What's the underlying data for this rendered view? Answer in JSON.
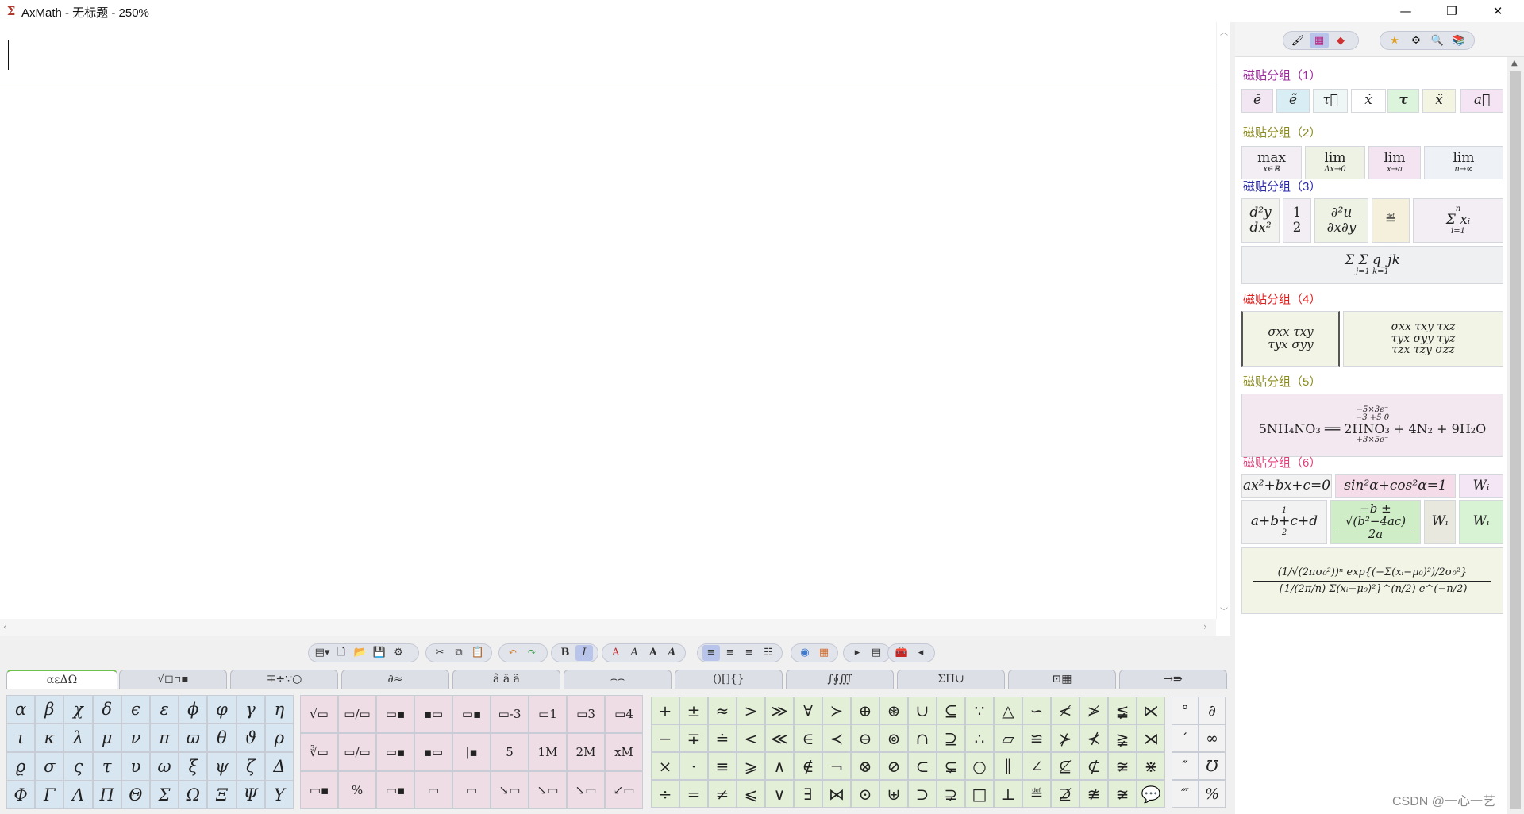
{
  "window": {
    "title": "AxMath - 无标题 - 250%",
    "app_icon": "Σ",
    "controls": {
      "minimize": "—",
      "maximize": "❐",
      "close": "✕"
    }
  },
  "editor": {
    "content": ""
  },
  "toolbar": {
    "groups": [
      [
        "▤▾",
        "🗋",
        "📂",
        "💾",
        "⚙"
      ],
      [
        "✂",
        "⧉",
        "📋"
      ],
      [
        "↶",
        "↷"
      ],
      [
        "B",
        "I"
      ],
      [
        "A",
        "A",
        "A",
        "A"
      ],
      [
        "≡",
        "≡",
        "≡",
        "☷"
      ],
      [
        "◉",
        "▦"
      ],
      [
        "▸",
        "▤"
      ],
      [
        "🧰",
        "◂"
      ]
    ]
  },
  "symbol_tabs": [
    "αεΔΩ",
    "√◻▫▪",
    "∓÷∵○",
    "∂≈",
    "â ä ã",
    "⌢⌢",
    "()[]{}",
    "∫∮∭",
    "ΣΠ∪",
    "⊡▦",
    "→⇛"
  ],
  "greek_grid": [
    [
      "α",
      "β",
      "χ",
      "δ",
      "ϵ",
      "ε",
      "ϕ",
      "φ",
      "γ",
      "η"
    ],
    [
      "ι",
      "κ",
      "λ",
      "μ",
      "ν",
      "π",
      "ϖ",
      "θ",
      "ϑ",
      "ρ"
    ],
    [
      "ϱ",
      "σ",
      "ς",
      "τ",
      "υ",
      "ω",
      "ξ",
      "ψ",
      "ζ",
      "Δ"
    ],
    [
      "Φ",
      "Γ",
      "Λ",
      "Π",
      "Θ",
      "Σ",
      "Ω",
      "Ξ",
      "Ψ",
      "Υ"
    ]
  ],
  "template_grid": [
    [
      "√▭",
      "▭/▭",
      "▭▪",
      "▪▭",
      "▭▪",
      "▭-3",
      "▭1",
      "▭3",
      "▭4"
    ],
    [
      "∛▭",
      "▭/▭",
      "▭▪",
      "▪▭",
      "|▪",
      "5",
      "1M",
      "2M",
      "xM"
    ],
    [
      "▭▪",
      "%",
      "▭▪",
      "▭",
      "▭",
      "↘▭",
      "↘▭",
      "↘▭",
      "↙▭"
    ]
  ],
  "template_labels": {
    "r0c5": "−3",
    "r0c6": "1",
    "r0c7": "3",
    "r0c8": "4",
    "r1c5": "5",
    "r1c6": "1M",
    "r1c7": "2M",
    "r1c8": "xM"
  },
  "operator_grid": [
    [
      "+",
      "±",
      "≈",
      ">",
      "≫",
      "∀",
      "≻",
      "⊕",
      "⊛",
      "∪",
      "⊆",
      "∵",
      "△",
      "∽",
      "≮",
      "≯",
      "≨",
      "⋉"
    ],
    [
      "−",
      "∓",
      "≐",
      "<",
      "≪",
      "∈",
      "≺",
      "⊖",
      "⊚",
      "∩",
      "⊇",
      "∴",
      "▱",
      "≌",
      "⊁",
      "⊀",
      "≩",
      "⋊"
    ],
    [
      "×",
      "·",
      "≡",
      "⩾",
      "∧",
      "∉",
      "¬",
      "⊗",
      "⊘",
      "⊂",
      "⊊",
      "○",
      "∥",
      "∠",
      "⊈",
      "⊄",
      "≆",
      "⋇"
    ],
    [
      "÷",
      "=",
      "≠",
      "⩽",
      "∨",
      "∃",
      "⋈",
      "⊙",
      "⊎",
      "⊃",
      "⊋",
      "□",
      "⊥",
      "≝",
      "⊉",
      "≇",
      "≆",
      "💬"
    ]
  ],
  "misc_grid": [
    [
      "°",
      "∂"
    ],
    [
      "′",
      "∞"
    ],
    [
      "″",
      "℧"
    ],
    [
      "‴",
      "%"
    ]
  ],
  "sidebar": {
    "toolbar_left": [
      "🖌",
      "▦",
      "◆"
    ],
    "toolbar_right": [
      "★",
      "⚙",
      "🔍",
      "📚"
    ],
    "groups": [
      {
        "label": "磁贴分组（1）",
        "color": "#9b2a9b"
      },
      {
        "label": "磁贴分组（2）",
        "color": "#8a8a1e"
      },
      {
        "label": "磁贴分组（3）",
        "color": "#2a2aa8"
      },
      {
        "label": "磁贴分组（4）",
        "color": "#e02020"
      },
      {
        "label": "磁贴分组（5）",
        "color": "#8a8a1e"
      },
      {
        "label": "磁贴分组（6）",
        "color": "#e0407a"
      }
    ],
    "tiles_g1": [
      "ē",
      "ẽ",
      "τ⃗",
      "ẋ",
      "τ",
      "ẍ",
      "a⃗"
    ],
    "tiles_g2": [
      {
        "top": "max",
        "sub": "x∈ℝ"
      },
      {
        "top": "lim",
        "sub": "Δx→0"
      },
      {
        "top": "lim",
        "sub": "x→a"
      },
      {
        "top": "lim",
        "sub": "n→∞"
      }
    ],
    "tiles_g3": {
      "deriv_num": "d²y",
      "deriv_den": "dx²",
      "half_num": "1",
      "half_den": "2",
      "pd_num": "∂²u",
      "pd_den": "∂x∂y",
      "def": "≝",
      "sum_top": "n",
      "sum_body": "Σ xᵢ",
      "sum_bottom": "i=1",
      "dsum": "Σ Σ q_jk",
      "dsum_sub": "j=1  k=1"
    },
    "tiles_g4": {
      "m2": [
        "σxx  τxy",
        "τyx  σyy"
      ],
      "m3": [
        "σxx  τxy  τxz",
        "τyx  σyy  τyz",
        "τzx  τzy  σzz"
      ]
    },
    "tiles_g5": {
      "top": "−5×3e⁻",
      "marks_top": "−3   +5                                0",
      "reaction": "5NH₄NO₃ ══ 2HNO₃ + 4N₂ + 9H₂O",
      "bottom": "+3×5e⁻"
    },
    "tiles_g6": {
      "quad": "ax²+bx+c=0",
      "trig": "sin²α+cos²α=1",
      "wi": "Wᵢ",
      "brace": "a+b+c+d",
      "brace_top": "1",
      "brace_bottom": "2",
      "root_num": "−b ± √(b²−4ac)",
      "root_den": "2a",
      "gauss_num": "(1/√(2πσ₀²))ⁿ exp{(−Σ(xᵢ−μ₀)²)/2σ₀²}",
      "gauss_den": "{1/(2π/n) Σ(xᵢ−μ₀)²}^(n/2) e^(−n/2)"
    }
  },
  "watermark": "CSDN @一心一艺"
}
